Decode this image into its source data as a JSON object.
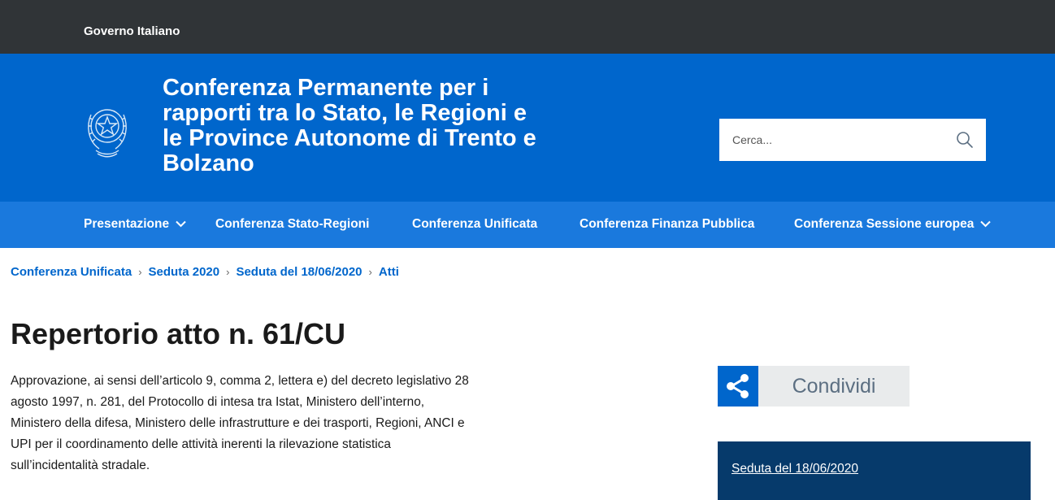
{
  "topbar": {
    "label": "Governo Italiano"
  },
  "header": {
    "site_title": "Conferenza Permanente per i rapporti tra lo Stato, le Regioni e le Province Autonome di Trento e Bolzano",
    "search_placeholder": "Cerca...",
    "emblem_icon": "repubblica-italiana-emblem-icon",
    "search_icon": "search-icon"
  },
  "nav": {
    "items": [
      {
        "label": "Presentazione",
        "has_dropdown": true
      },
      {
        "label": "Conferenza Stato-Regioni",
        "has_dropdown": false
      },
      {
        "label": "Conferenza Unificata",
        "has_dropdown": false
      },
      {
        "label": "Conferenza Finanza Pubblica",
        "has_dropdown": false
      },
      {
        "label": "Conferenza Sessione europea",
        "has_dropdown": true
      }
    ]
  },
  "breadcrumb": [
    "Conferenza Unificata",
    "Seduta 2020",
    "Seduta del 18/06/2020",
    "Atti"
  ],
  "page": {
    "title": "Repertorio atto n. 61/CU",
    "description": "Approvazione, ai sensi dell’articolo 9, comma 2, lettera e) del decreto legislativo 28 agosto 1997, n. 281, del Protocollo di intesa tra Istat, Ministero dell’interno, Ministero della difesa, Ministero delle infrastrutture e dei trasporti, Regioni, ANCI e UPI per il coordinamento delle attività inerenti la rilevazione statistica sull’incidentalità stradale."
  },
  "share": {
    "label": "Condividi",
    "icon": "share-icon"
  },
  "related": {
    "link": "Seduta del 18/06/2020"
  },
  "colors": {
    "topbar": "#303437",
    "header": "#0066cc",
    "navbar": "#1a79dd",
    "related_box": "#063a6b",
    "link": "#0066cc"
  }
}
